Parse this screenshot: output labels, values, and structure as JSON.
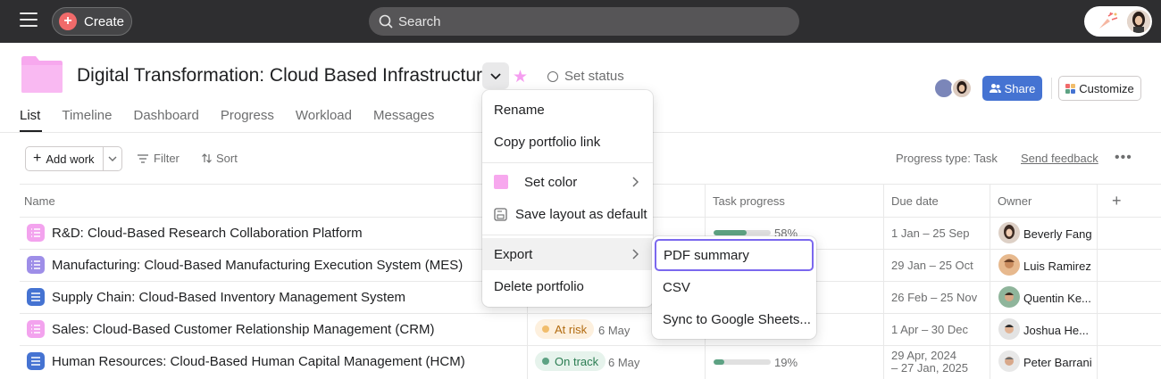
{
  "topbar": {
    "create_label": "Create",
    "search_placeholder": "Search"
  },
  "project": {
    "title": "Digital Transformation: Cloud Based Infrastructure",
    "set_status": "Set status",
    "share_label": "Share",
    "customize_label": "Customize",
    "folder_color": "#f7a8ee"
  },
  "tabs": [
    "List",
    "Timeline",
    "Dashboard",
    "Progress",
    "Workload",
    "Messages"
  ],
  "toolbar": {
    "add_work": "Add work",
    "filter": "Filter",
    "sort": "Sort",
    "progress_type": "Progress type: Task",
    "send_feedback": "Send feedback"
  },
  "table": {
    "headers": {
      "name": "Name",
      "task_progress": "Task progress",
      "due_date": "Due date",
      "owner": "Owner"
    },
    "rows": [
      {
        "name": "R&D: Cloud-Based Research Collaboration Platform",
        "icon_color": "#f3a3ee",
        "status": "",
        "status_date": "",
        "progress": "58%",
        "progress_value": 0.58,
        "due": "1 Jan – 25 Sep",
        "due2": "",
        "owner": "Beverly Fang"
      },
      {
        "name": "Manufacturing: Cloud-Based Manufacturing Execution System (MES)",
        "icon_color": "#9e8ee8",
        "status": "",
        "status_date": "",
        "progress": "",
        "progress_value": 0,
        "due": "29 Jan – 25 Oct",
        "due2": "",
        "owner": "Luis Ramirez"
      },
      {
        "name": "Supply Chain: Cloud-Based Inventory Management System",
        "icon_color": "#4573d2",
        "status": "",
        "status_date": "",
        "progress": "",
        "progress_value": 0,
        "due": "26 Feb – 25 Nov",
        "due2": "",
        "owner": "Quentin Ke..."
      },
      {
        "name": "Sales: Cloud-Based Customer Relationship Management (CRM)",
        "icon_color": "#f3a3ee",
        "status": "At risk",
        "status_date": "6 May",
        "progress": "",
        "progress_value": 0,
        "due": "1 Apr – 30 Dec",
        "due2": "",
        "owner": "Joshua He..."
      },
      {
        "name": "Human Resources: Cloud-Based Human Capital Management (HCM)",
        "icon_color": "#4573d2",
        "status": "On track",
        "status_date": "6 May",
        "progress": "19%",
        "progress_value": 0.19,
        "due": "29 Apr, 2024",
        "due2": "– 27 Jan, 2025",
        "owner": "Peter Barrani"
      }
    ]
  },
  "menu": {
    "rename": "Rename",
    "copy_link": "Copy portfolio link",
    "set_color": "Set color",
    "save_layout": "Save layout as default",
    "export": "Export",
    "delete": "Delete portfolio",
    "color_swatch": "#f7a8ee"
  },
  "submenu": {
    "pdf": "PDF summary",
    "csv": "CSV",
    "sheets": "Sync to Google Sheets..."
  },
  "colors": {
    "at_risk_bg": "#fdf0de",
    "at_risk_text": "#b26b10",
    "at_risk_dot": "#f1bd6c",
    "on_track_bg": "#e6f3ec",
    "on_track_text": "#2b7d52",
    "on_track_dot": "#5da283"
  }
}
